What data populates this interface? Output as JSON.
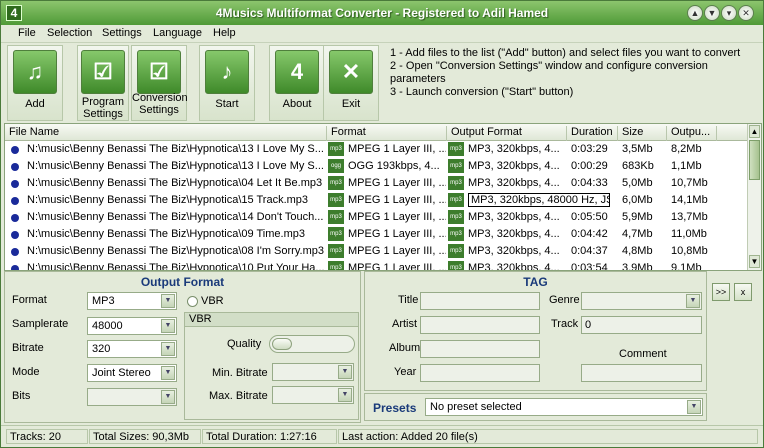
{
  "window": {
    "title": "4Musics Multiformat Converter - Registered to Adil Hamed",
    "app_icon": "4",
    "accent": "#5aa63f"
  },
  "menu": [
    "File",
    "Selection",
    "Settings",
    "Language",
    "Help"
  ],
  "toolbar": {
    "add": "Add",
    "program_settings": "Program Settings",
    "conversion_settings": "Conversion Settings",
    "start": "Start",
    "about": "About",
    "exit": "Exit",
    "about_icon_text": "4"
  },
  "steps": [
    "1 - Add files to the list (\"Add\" button) and select files you want to convert",
    "2 - Open \"Conversion Settings\" window and configure conversion parameters",
    "3 - Launch conversion (\"Start\" button)"
  ],
  "grid": {
    "columns": [
      "File Name",
      "Format",
      "Output Format",
      "Duration",
      "Size",
      "Outpu..."
    ],
    "rows": [
      {
        "file": "N:\\music\\Benny Benassi The Biz\\Hypnotica\\13 I Love My S...",
        "badge": "mp3",
        "format": "MPEG 1 Layer III, ...",
        "outbadge": "mp3",
        "output": "MP3, 320kbps, 4...",
        "duration": "0:03:29",
        "size": "3,5Mb",
        "outsize": "8,2Mb"
      },
      {
        "file": "N:\\music\\Benny Benassi The Biz\\Hypnotica\\13 I Love My S...",
        "badge": "ogg",
        "format": "OGG 193kbps, 4...",
        "outbadge": "mp3",
        "output": "MP3, 320kbps, 4...",
        "duration": "0:00:29",
        "size": "683Kb",
        "outsize": "1,1Mb"
      },
      {
        "file": "N:\\music\\Benny Benassi The Biz\\Hypnotica\\04 Let It Be.mp3",
        "badge": "mp3",
        "format": "MPEG 1 Layer III, ...",
        "outbadge": "mp3",
        "output": "MP3, 320kbps, 4...",
        "duration": "0:04:33",
        "size": "5,0Mb",
        "outsize": "10,7Mb"
      },
      {
        "file": "N:\\music\\Benny Benassi The Biz\\Hypnotica\\15 Track.mp3",
        "badge": "mp3",
        "format": "MPEG 1 Layer III, ...",
        "outbadge": "mp3",
        "output": "MP3, 320kbps, 48000 Hz, JS",
        "duration": "0:05:38",
        "size": "6,0Mb",
        "outsize": "14,1Mb"
      },
      {
        "file": "N:\\music\\Benny Benassi The Biz\\Hypnotica\\14 Don't Touch...",
        "badge": "mp3",
        "format": "MPEG 1 Layer III, ...",
        "outbadge": "mp3",
        "output": "MP3, 320kbps, 4...",
        "duration": "0:05:50",
        "size": "5,9Mb",
        "outsize": "13,7Mb"
      },
      {
        "file": "N:\\music\\Benny Benassi The Biz\\Hypnotica\\09 Time.mp3",
        "badge": "mp3",
        "format": "MPEG 1 Layer III, ...",
        "outbadge": "mp3",
        "output": "MP3, 320kbps, 4...",
        "duration": "0:04:42",
        "size": "4,7Mb",
        "outsize": "11,0Mb"
      },
      {
        "file": "N:\\music\\Benny Benassi The Biz\\Hypnotica\\08 I'm Sorry.mp3",
        "badge": "mp3",
        "format": "MPEG 1 Layer III, ...",
        "outbadge": "mp3",
        "output": "MP3, 320kbps, 4...",
        "duration": "0:04:37",
        "size": "4,8Mb",
        "outsize": "10,8Mb"
      },
      {
        "file": "N:\\music\\Benny Benassi The Biz\\Hypnotica\\10 Put Your Ha...",
        "badge": "mp3",
        "format": "MPEG 1 Layer III, ...",
        "outbadge": "mp3",
        "output": "MP3, 320kbps, 4...",
        "duration": "0:03:54",
        "size": "3,9Mb",
        "outsize": "9,1Mb"
      }
    ]
  },
  "output_format": {
    "title": "Output Format",
    "format_label": "Format",
    "format_value": "MP3",
    "samplerate_label": "Samplerate",
    "samplerate_value": "48000",
    "bitrate_label": "Bitrate",
    "bitrate_value": "320",
    "mode_label": "Mode",
    "mode_value": "Joint Stereo",
    "bits_label": "Bits",
    "bits_value": "",
    "vbr_checkbox": "VBR",
    "vbr_group": "VBR",
    "quality_label": "Quality",
    "min_bitrate_label": "Min. Bitrate",
    "max_bitrate_label": "Max. Bitrate"
  },
  "tag": {
    "title": "TAG",
    "title_label": "Title",
    "artist_label": "Artist",
    "album_label": "Album",
    "year_label": "Year",
    "genre_label": "Genre",
    "track_label": "Track",
    "track_value": "0",
    "comment_label": "Comment",
    "copy_button": ">>",
    "clear_button": "x"
  },
  "presets": {
    "label": "Presets",
    "value": "No preset selected"
  },
  "status": {
    "tracks": "Tracks: 20",
    "total_sizes": "Total Sizes: 90,3Mb",
    "total_duration": "Total Duration: 1:27:16",
    "last_action": "Last action: Added 20 file(s)"
  }
}
